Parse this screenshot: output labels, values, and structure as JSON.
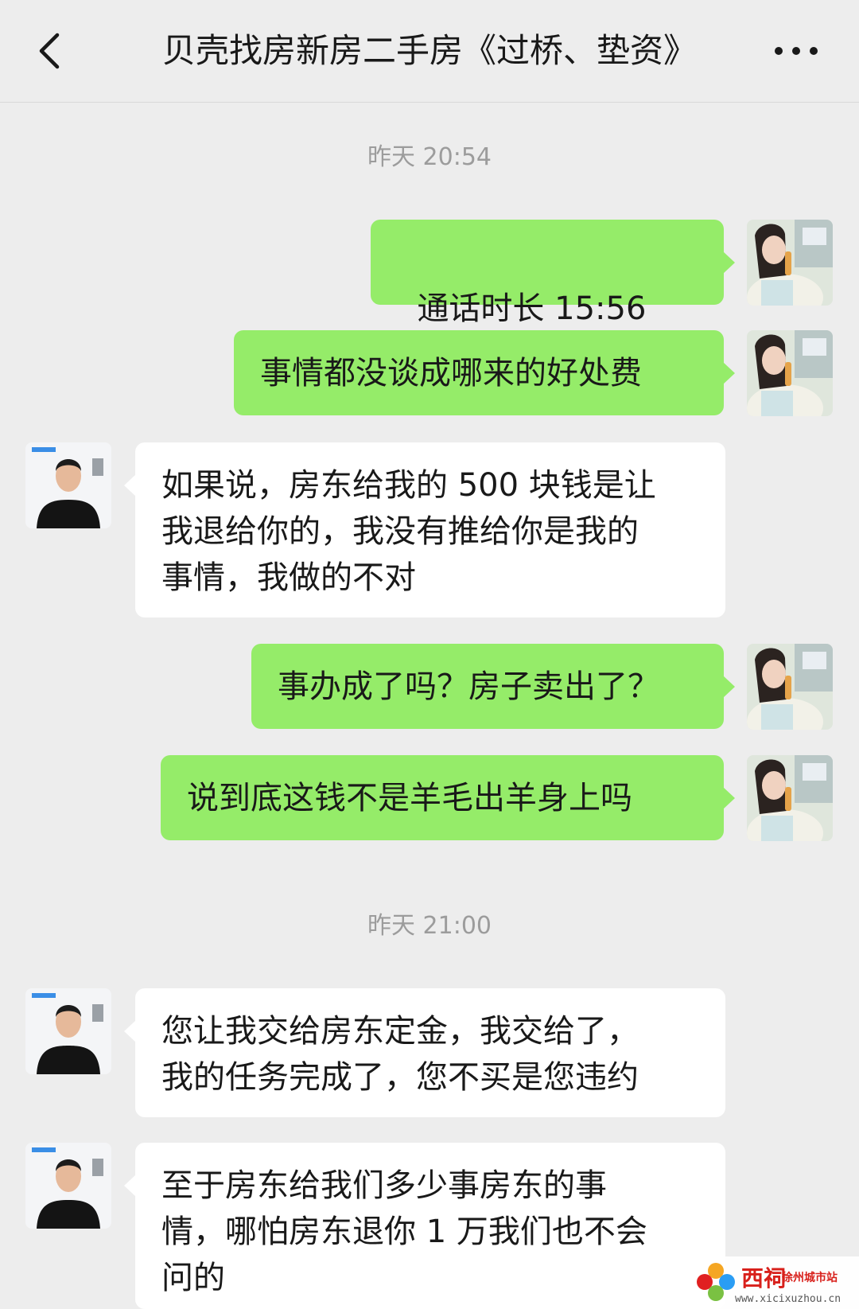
{
  "header": {
    "title": "贝壳找房新房二手房《过桥、垫资》"
  },
  "timestamps": [
    "昨天 20:54",
    "昨天 21:00"
  ],
  "messages": [
    {
      "from": "me",
      "type": "call",
      "text": "通话时长 15:56"
    },
    {
      "from": "me",
      "type": "text",
      "text": "事情都没谈成哪来的好处费"
    },
    {
      "from": "agent",
      "type": "text",
      "text": "如果说，房东给我的 500 块钱是让\n我退给你的，我没有推给你是我的\n事情，我做的不对"
    },
    {
      "from": "me",
      "type": "text",
      "text": "事办成了吗？房子卖出了？"
    },
    {
      "from": "me",
      "type": "text",
      "text": "说到底这钱不是羊毛出羊身上吗"
    },
    {
      "from": "agent",
      "type": "text",
      "text": "您让我交给房东定金，我交给了，\n我的任务完成了，您不买是您违约"
    },
    {
      "from": "agent",
      "type": "text",
      "text": "至于房东给我们多少事房东的事\n情，哪怕房东退你 1 万我们也不会\n问的"
    }
  ],
  "watermark": {
    "logo": "西祠",
    "subtitle": "徐州城市站",
    "url": "www.xicixuzhou.cn"
  },
  "colors": {
    "background": "#ededed",
    "outgoing_bubble": "#95ec69",
    "incoming_bubble": "#ffffff",
    "timestamp_text": "#9c9c9c"
  },
  "icons": [
    "back-arrow-icon",
    "more-dots-icon",
    "phone-call-icon"
  ]
}
